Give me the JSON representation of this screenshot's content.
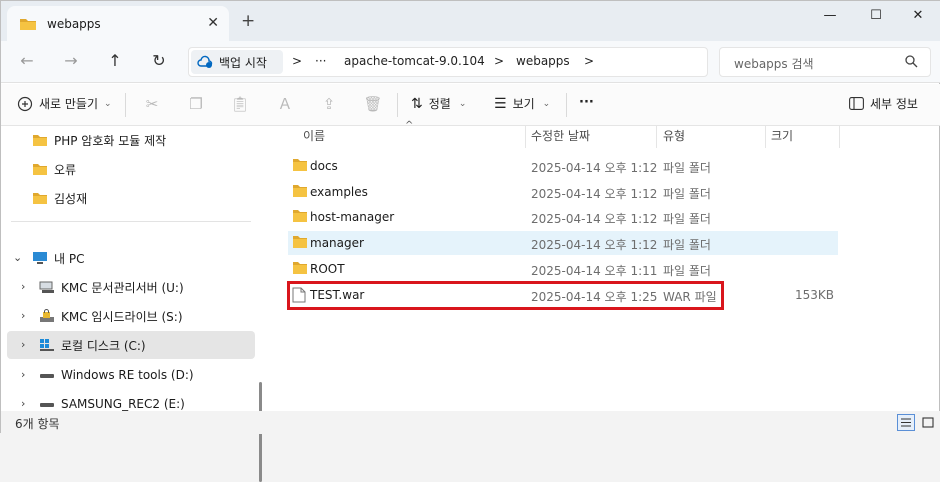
{
  "tab": {
    "title": "webapps",
    "close": "✕",
    "new_tab": "+"
  },
  "window_controls": {
    "minimize": "—",
    "maximize": "☐",
    "close": "✕"
  },
  "address": {
    "backup_label": "백업 시작",
    "ellipsis": "···",
    "crumbs": [
      "apache-tomcat-9.0.104",
      "webapps"
    ],
    "separator": ">"
  },
  "search": {
    "placeholder": "webapps 검색"
  },
  "toolbar": {
    "new_label": "새로 만들기",
    "sort_label": "정렬",
    "view_label": "보기",
    "more_label": "···",
    "details_label": "세부 정보"
  },
  "sidebar": {
    "items": [
      {
        "label": "PHP 암호화 모듈 제작",
        "icon": "folder-icon"
      },
      {
        "label": "오류",
        "icon": "folder-icon"
      },
      {
        "label": "김성재",
        "icon": "folder-icon"
      },
      {
        "label": "내 PC",
        "icon": "pc-icon"
      },
      {
        "label": "KMC 문서관리서버 (U:)",
        "icon": "network-drive-icon"
      },
      {
        "label": "KMC 임시드라이브 (S:)",
        "icon": "locked-drive-icon"
      },
      {
        "label": "로컬 디스크 (C:)",
        "icon": "windows-drive-icon"
      },
      {
        "label": "Windows RE tools (D:)",
        "icon": "drive-icon"
      },
      {
        "label": "SAMSUNG_REC2 (E:)",
        "icon": "drive-icon"
      }
    ]
  },
  "columns": {
    "name": "이름",
    "date": "수정한 날짜",
    "type": "유형",
    "size": "크기"
  },
  "files": [
    {
      "name": "docs",
      "date": "2025-04-14 오후 1:12",
      "type": "파일 폴더",
      "size": "",
      "icon": "folder-icon"
    },
    {
      "name": "examples",
      "date": "2025-04-14 오후 1:12",
      "type": "파일 폴더",
      "size": "",
      "icon": "folder-icon"
    },
    {
      "name": "host-manager",
      "date": "2025-04-14 오후 1:12",
      "type": "파일 폴더",
      "size": "",
      "icon": "folder-icon"
    },
    {
      "name": "manager",
      "date": "2025-04-14 오후 1:12",
      "type": "파일 폴더",
      "size": "",
      "icon": "folder-icon"
    },
    {
      "name": "ROOT",
      "date": "2025-04-14 오후 1:11",
      "type": "파일 폴더",
      "size": "",
      "icon": "folder-icon"
    },
    {
      "name": "TEST.war",
      "date": "2025-04-14 오후 1:25",
      "type": "WAR 파일",
      "size": "153KB",
      "icon": "file-icon"
    }
  ],
  "status": {
    "count": "6개 항목"
  },
  "colors": {
    "folder": "#f5c342",
    "folder_dark": "#e0a82e",
    "highlight_border": "#d9161c",
    "hover_row": "#e5f3fb",
    "accent": "#0067c0"
  }
}
